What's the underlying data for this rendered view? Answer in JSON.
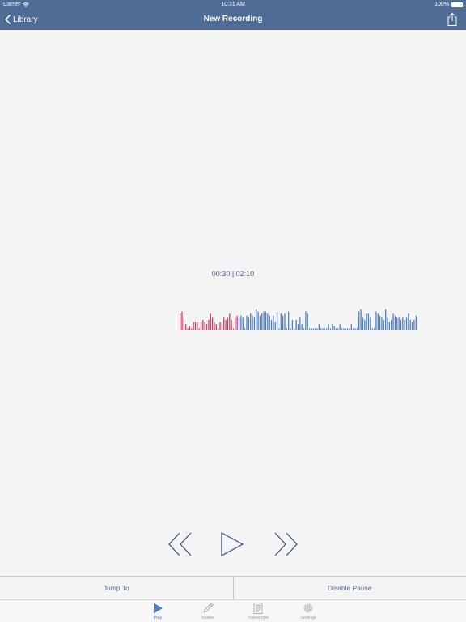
{
  "status_bar": {
    "carrier": "Carrier",
    "time": "10:31 AM",
    "battery": "100%",
    "icons": [
      "wifi-icon",
      "battery-icon"
    ]
  },
  "nav": {
    "back_label": "Library",
    "title": "New Recording",
    "back_icon": "chevron-left-icon",
    "share_icon": "share-icon"
  },
  "player": {
    "timer": "00:30 | 02:10",
    "played_fraction": 0.25,
    "colors": {
      "played": "#c0436b",
      "remaining": "#4f7cc4"
    },
    "waveform_levels": [
      0.8,
      0.9,
      0.6,
      0.3,
      0.1,
      0.2,
      0.1,
      0.4,
      0.4,
      0.4,
      0.1,
      0.4,
      0.5,
      0.4,
      0.3,
      0.5,
      0.8,
      0.6,
      0.4,
      0.3,
      0.1,
      0.4,
      0.3,
      0.6,
      0.5,
      0.6,
      0.8,
      0.5,
      0.1,
      0.6,
      0.7,
      0.6,
      0.7,
      0.6,
      0.1,
      0.7,
      0.6,
      0.8,
      0.7,
      0.6,
      1.0,
      0.9,
      0.7,
      0.8,
      0.9,
      0.9,
      0.8,
      0.7,
      0.5,
      0.7,
      0.4,
      0.9,
      0.1,
      0.8,
      0.7,
      0.8,
      0.1,
      0.9,
      0.1,
      0.5,
      0.1,
      0.5,
      0.3,
      0.6,
      0.3,
      0.1,
      0.9,
      0.8,
      0.1,
      0.1,
      0.1,
      0.1,
      0.1,
      0.3,
      0.1,
      0.1,
      0.1,
      0.1,
      0.3,
      0.1,
      0.3,
      0.2,
      0.1,
      0.1,
      0.3,
      0.1,
      0.1,
      0.1,
      0.1,
      0.1,
      0.3,
      0.1,
      0.1,
      0.1,
      0.9,
      1.0,
      0.6,
      0.5,
      0.8,
      0.8,
      0.6,
      0.1,
      0.1,
      0.9,
      0.8,
      0.7,
      0.6,
      0.5,
      1.0,
      0.6,
      0.4,
      0.5,
      0.8,
      0.7,
      0.6,
      0.6,
      0.5,
      0.6,
      0.5,
      0.6,
      0.8,
      0.5,
      0.4,
      0.5,
      0.7
    ]
  },
  "controls": {
    "rewind_icon": "rewind-icon",
    "play_icon": "play-icon",
    "forward_icon": "fast-forward-icon"
  },
  "actions": {
    "jump_to": "Jump To",
    "disable_pause": "Disable Pause"
  },
  "tabs": [
    {
      "label": "Play",
      "icon": "play-icon",
      "active": true
    },
    {
      "label": "Notes",
      "icon": "pencil-icon",
      "active": false
    },
    {
      "label": "Transcribe",
      "icon": "document-icon",
      "active": false
    },
    {
      "label": "Settings",
      "icon": "gear-icon",
      "active": false
    }
  ]
}
